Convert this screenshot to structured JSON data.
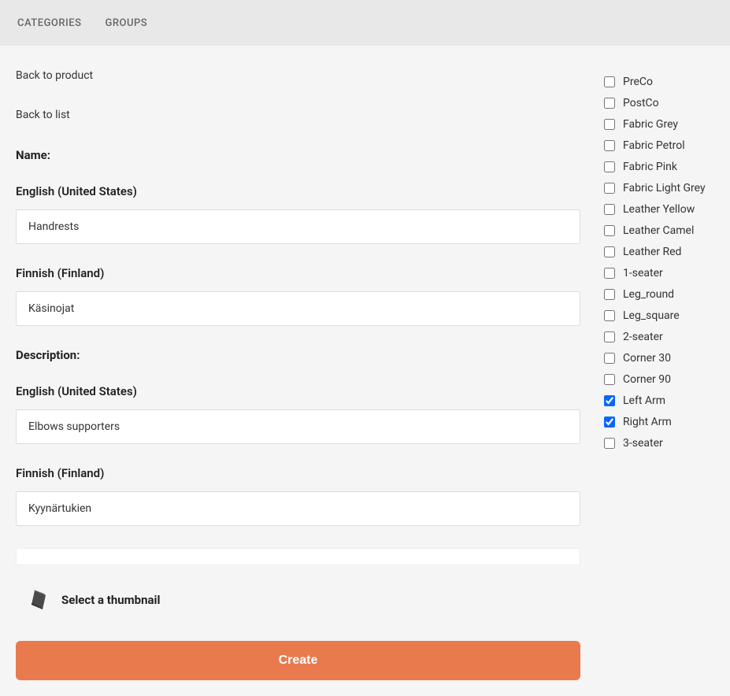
{
  "tabs": {
    "categories": "CATEGORIES",
    "groups": "GROUPS"
  },
  "links": {
    "back_product": "Back to product",
    "back_list": "Back to list"
  },
  "form": {
    "name_label": "Name:",
    "desc_label": "Description:",
    "lang_en": "English (United States)",
    "lang_fi": "Finnish (Finland)",
    "name_en": "Handrests",
    "name_fi": "Käsinojat",
    "desc_en": "Elbows supporters",
    "desc_fi": "Kyynärtukien",
    "thumb_label": "Select a thumbnail",
    "create_btn": "Create"
  },
  "options": [
    {
      "label": "PreCo",
      "checked": false
    },
    {
      "label": "PostCo",
      "checked": false
    },
    {
      "label": "Fabric Grey",
      "checked": false
    },
    {
      "label": "Fabric Petrol",
      "checked": false
    },
    {
      "label": "Fabric Pink",
      "checked": false
    },
    {
      "label": "Fabric Light Grey",
      "checked": false
    },
    {
      "label": "Leather Yellow",
      "checked": false
    },
    {
      "label": "Leather Camel",
      "checked": false
    },
    {
      "label": "Leather Red",
      "checked": false
    },
    {
      "label": "1-seater",
      "checked": false
    },
    {
      "label": "Leg_round",
      "checked": false
    },
    {
      "label": "Leg_square",
      "checked": false
    },
    {
      "label": "2-seater",
      "checked": false
    },
    {
      "label": "Corner 30",
      "checked": false
    },
    {
      "label": "Corner 90",
      "checked": false
    },
    {
      "label": "Left Arm",
      "checked": true
    },
    {
      "label": "Right Arm",
      "checked": true
    },
    {
      "label": "3-seater",
      "checked": false
    }
  ]
}
